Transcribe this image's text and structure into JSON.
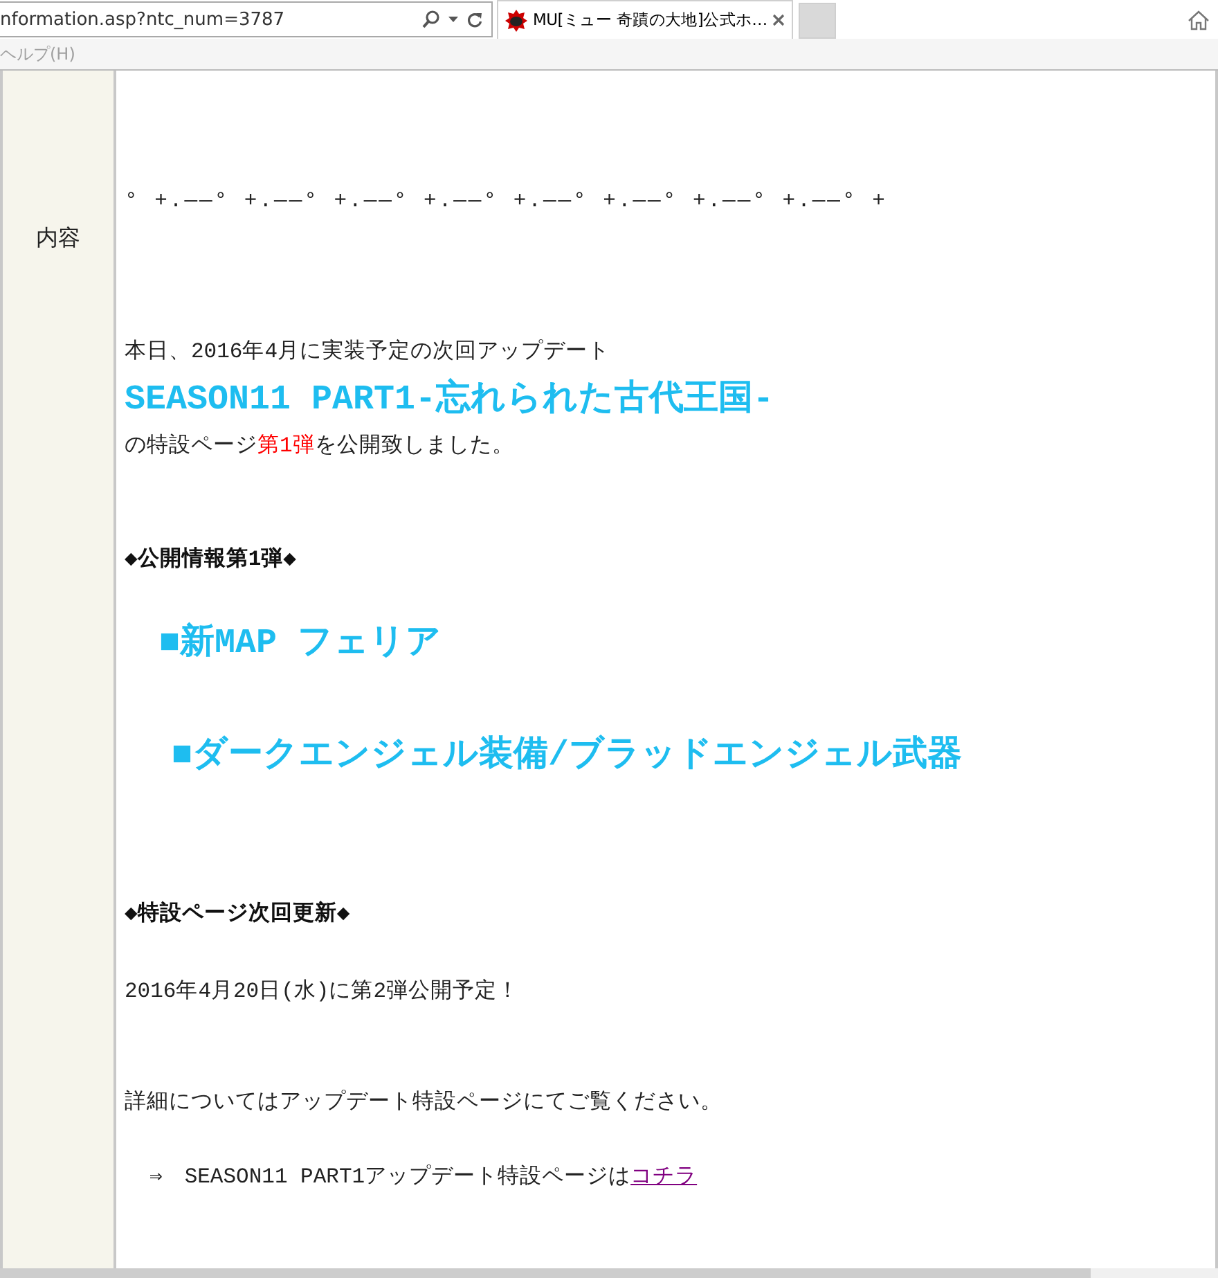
{
  "address_bar": {
    "url": "nformation.asp?ntc_num=3787"
  },
  "tabs": [
    {
      "label": "MU[ミュー 奇蹟の大地]公式ホ…",
      "selected": true
    }
  ],
  "menu": [
    {
      "label": "ヘルプ(H)",
      "disabled": true
    }
  ],
  "notice": {
    "label": "内容",
    "blocks": [
      {
        "kind": "ornament",
        "segments": [
          {
            "kind": "plain",
            "text": "° +.――° +.――° +.――° +.――° +.――° +.――° +.――° +.――° +"
          }
        ]
      },
      {
        "kind": "text",
        "segments": [
          {
            "kind": "plain",
            "text": "本日、2016年4月に実装予定の次回アップデート"
          }
        ]
      },
      {
        "kind": "title",
        "segments": [
          {
            "kind": "plain",
            "text": "SEASON11 PART1-忘れられた古代王国-"
          }
        ]
      },
      {
        "kind": "text",
        "segments": [
          {
            "kind": "plain",
            "text": "の特設ページ"
          },
          {
            "kind": "highlight",
            "text": "第1弾"
          },
          {
            "kind": "plain",
            "text": "を公開致しました。"
          }
        ]
      },
      {
        "kind": "heading",
        "segments": [
          {
            "kind": "plain",
            "text": "◆公開情報第1弾◆"
          }
        ]
      },
      {
        "kind": "feature",
        "segments": [
          {
            "kind": "plain",
            "text": "■新MAP フェリア"
          }
        ]
      },
      {
        "kind": "feature",
        "segments": [
          {
            "kind": "plain",
            "text": "■ダークエンジェル装備/ブラッドエンジェル武器"
          }
        ]
      },
      {
        "kind": "heading",
        "segments": [
          {
            "kind": "plain",
            "text": "◆特設ページ次回更新◆"
          }
        ]
      },
      {
        "kind": "text",
        "segments": [
          {
            "kind": "plain",
            "text": "2016年4月20日(水)に第2弾公開予定！"
          }
        ]
      },
      {
        "kind": "text",
        "segments": [
          {
            "kind": "plain",
            "text": "詳細についてはアップデート特設ページにてご覧ください。"
          }
        ]
      },
      {
        "kind": "text",
        "segments": [
          {
            "kind": "plain",
            "text": "⇒　SEASON11 PART1アップデート特設ページは"
          },
          {
            "kind": "link",
            "text": "コチラ"
          }
        ]
      }
    ]
  }
}
